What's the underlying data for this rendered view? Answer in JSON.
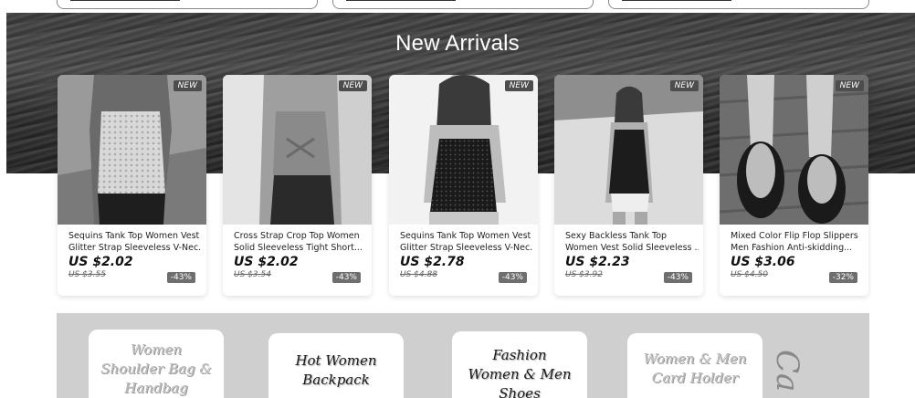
{
  "section": {
    "title": "New Arrivals"
  },
  "products": [
    {
      "badge": "NEW",
      "name_line1": "Sequins Tank Top Women Vest",
      "name_line2": "Glitter Strap Sleeveless V-Nec...",
      "price": "US $2.02",
      "old_price": "US $3.55",
      "discount": "-43%"
    },
    {
      "badge": "NEW",
      "name_line1": "Cross Strap Crop Top Women",
      "name_line2": "Solid Sleeveless Tight Short...",
      "price": "US $2.02",
      "old_price": "US $3.54",
      "discount": "-43%"
    },
    {
      "badge": "NEW",
      "name_line1": "Sequins Tank Top Women Vest",
      "name_line2": "Glitter Strap Sleeveless V-Nec...",
      "price": "US $2.78",
      "old_price": "US $4.88",
      "discount": "-43%"
    },
    {
      "badge": "NEW",
      "name_line1": "Sexy Backless Tank Top",
      "name_line2": "Women Vest Solid Sleeveless ...",
      "price": "US $2.23",
      "old_price": "US $3.92",
      "discount": "-43%"
    },
    {
      "badge": "NEW",
      "name_line1": "Mixed Color Flip Flop Slippers",
      "name_line2": "Men Fashion Anti-skidding...",
      "price": "US $3.06",
      "old_price": "US $4.50",
      "discount": "-32%"
    }
  ],
  "categories": [
    {
      "lines": [
        "Women",
        "Shoulder Bag &",
        "Handbag"
      ],
      "style": "light"
    },
    {
      "lines": [
        "Hot Women",
        "Backpack"
      ],
      "style": "dark"
    },
    {
      "lines": [
        "Fashion",
        "Women & Men",
        "Shoes"
      ],
      "style": "dark"
    },
    {
      "lines": [
        "Women & Men",
        "Card Holder"
      ],
      "style": "light"
    }
  ],
  "category_partial": "Ca",
  "colors": {
    "hero_dark": "#2e2e2e",
    "card_bg": "#ffffff",
    "panel_bg": "#cfcfcf",
    "discount_bg": "#6e6e6e",
    "badge_bg": "#4d4d4d"
  }
}
